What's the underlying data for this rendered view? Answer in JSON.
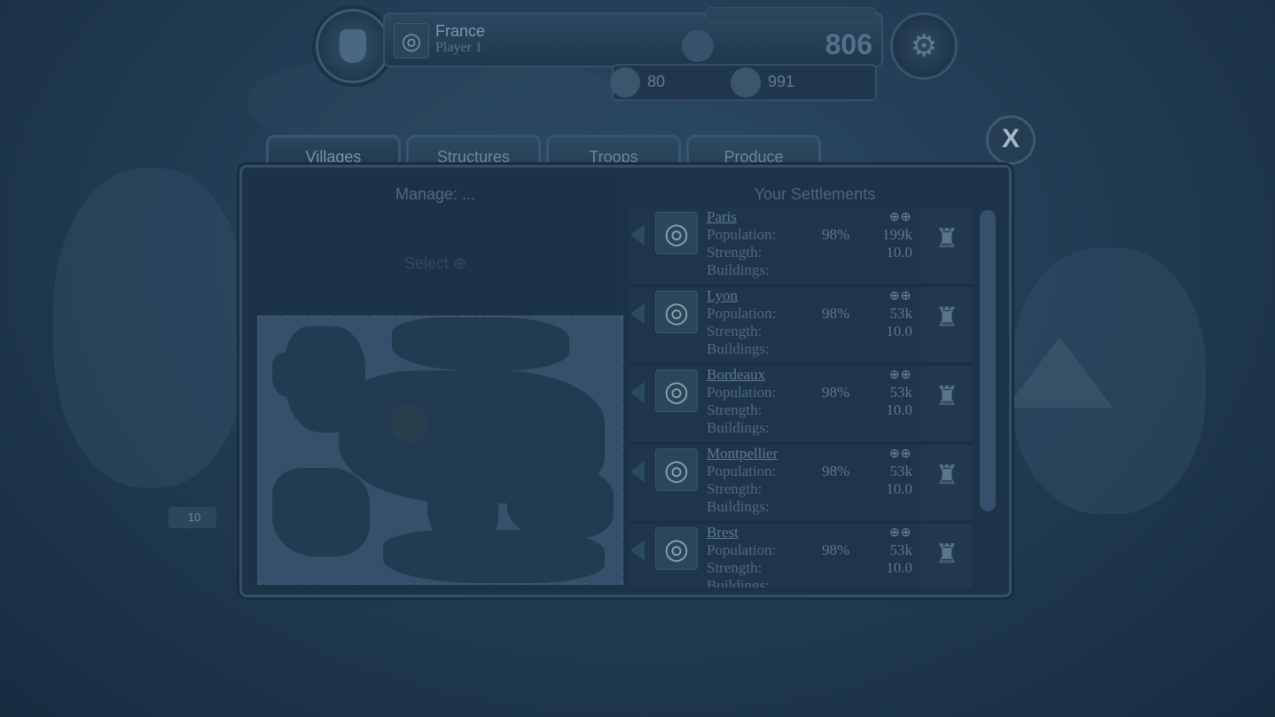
{
  "header": {
    "country": "France",
    "player": "Player 1",
    "gold": "806",
    "resources": [
      {
        "name": "lumber",
        "icon": "lumber-icon",
        "value": "80"
      },
      {
        "name": "food",
        "icon": "food-icon",
        "value": "991"
      }
    ]
  },
  "tabs": [
    {
      "label": "Villages",
      "active": true
    },
    {
      "label": "Structures",
      "active": false
    },
    {
      "label": "Troops",
      "active": false
    },
    {
      "label": "Produce",
      "active": false
    }
  ],
  "close_label": "X",
  "manage": {
    "title": "Manage: ...",
    "select": "Select ⊕"
  },
  "settlements": {
    "title": "Your Settlements",
    "labels": {
      "population": "Population:",
      "strength": "Strength:",
      "buildings": "Buildings:"
    },
    "items": [
      {
        "name": "Paris",
        "percent": "98%",
        "population": "199k",
        "strength": "10.0",
        "modifiers": "⊕⊕"
      },
      {
        "name": "Lyon",
        "percent": "98%",
        "population": "53k",
        "strength": "10.0",
        "modifiers": "⊕⊕"
      },
      {
        "name": "Bordeaux",
        "percent": "98%",
        "population": "53k",
        "strength": "10.0",
        "modifiers": "⊕⊕"
      },
      {
        "name": "Montpellier",
        "percent": "98%",
        "population": "53k",
        "strength": "10.0",
        "modifiers": "⊕⊕"
      },
      {
        "name": "Brest",
        "percent": "98%",
        "population": "53k",
        "strength": "10.0",
        "modifiers": "⊕⊕"
      }
    ]
  },
  "map_markers": [
    {
      "value": "10"
    }
  ]
}
